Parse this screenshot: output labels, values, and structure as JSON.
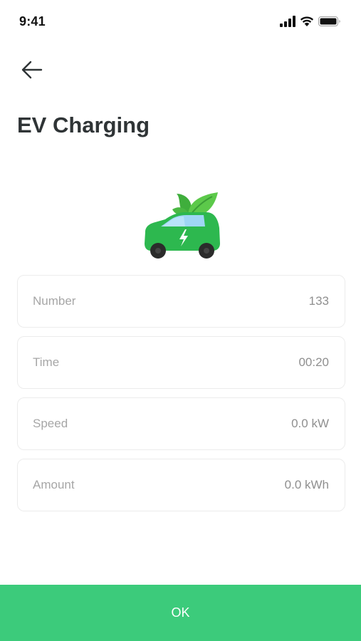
{
  "status_bar": {
    "time": "9:41",
    "icons": [
      "signal-icon",
      "wifi-icon",
      "battery-icon"
    ]
  },
  "header": {
    "back_icon": "arrow-left-icon",
    "title": "EV Charging"
  },
  "illustration": {
    "icon": "eco-car-icon",
    "colors": {
      "car_body": "#2db84f",
      "window": "#9fd6f5",
      "leaf": "#4cc44a",
      "wheel": "#2b2b2b"
    }
  },
  "details": [
    {
      "label": "Number",
      "value": "133"
    },
    {
      "label": "Time",
      "value": "00:20"
    },
    {
      "label": "Speed",
      "value": "0.0 kW"
    },
    {
      "label": "Amount",
      "value": "0.0 kWh"
    }
  ],
  "footer": {
    "ok_label": "OK"
  },
  "colors": {
    "accent": "#3ccb7b",
    "title": "#2f3436",
    "card_border": "#ececec",
    "label_text": "#a6a6a6"
  }
}
